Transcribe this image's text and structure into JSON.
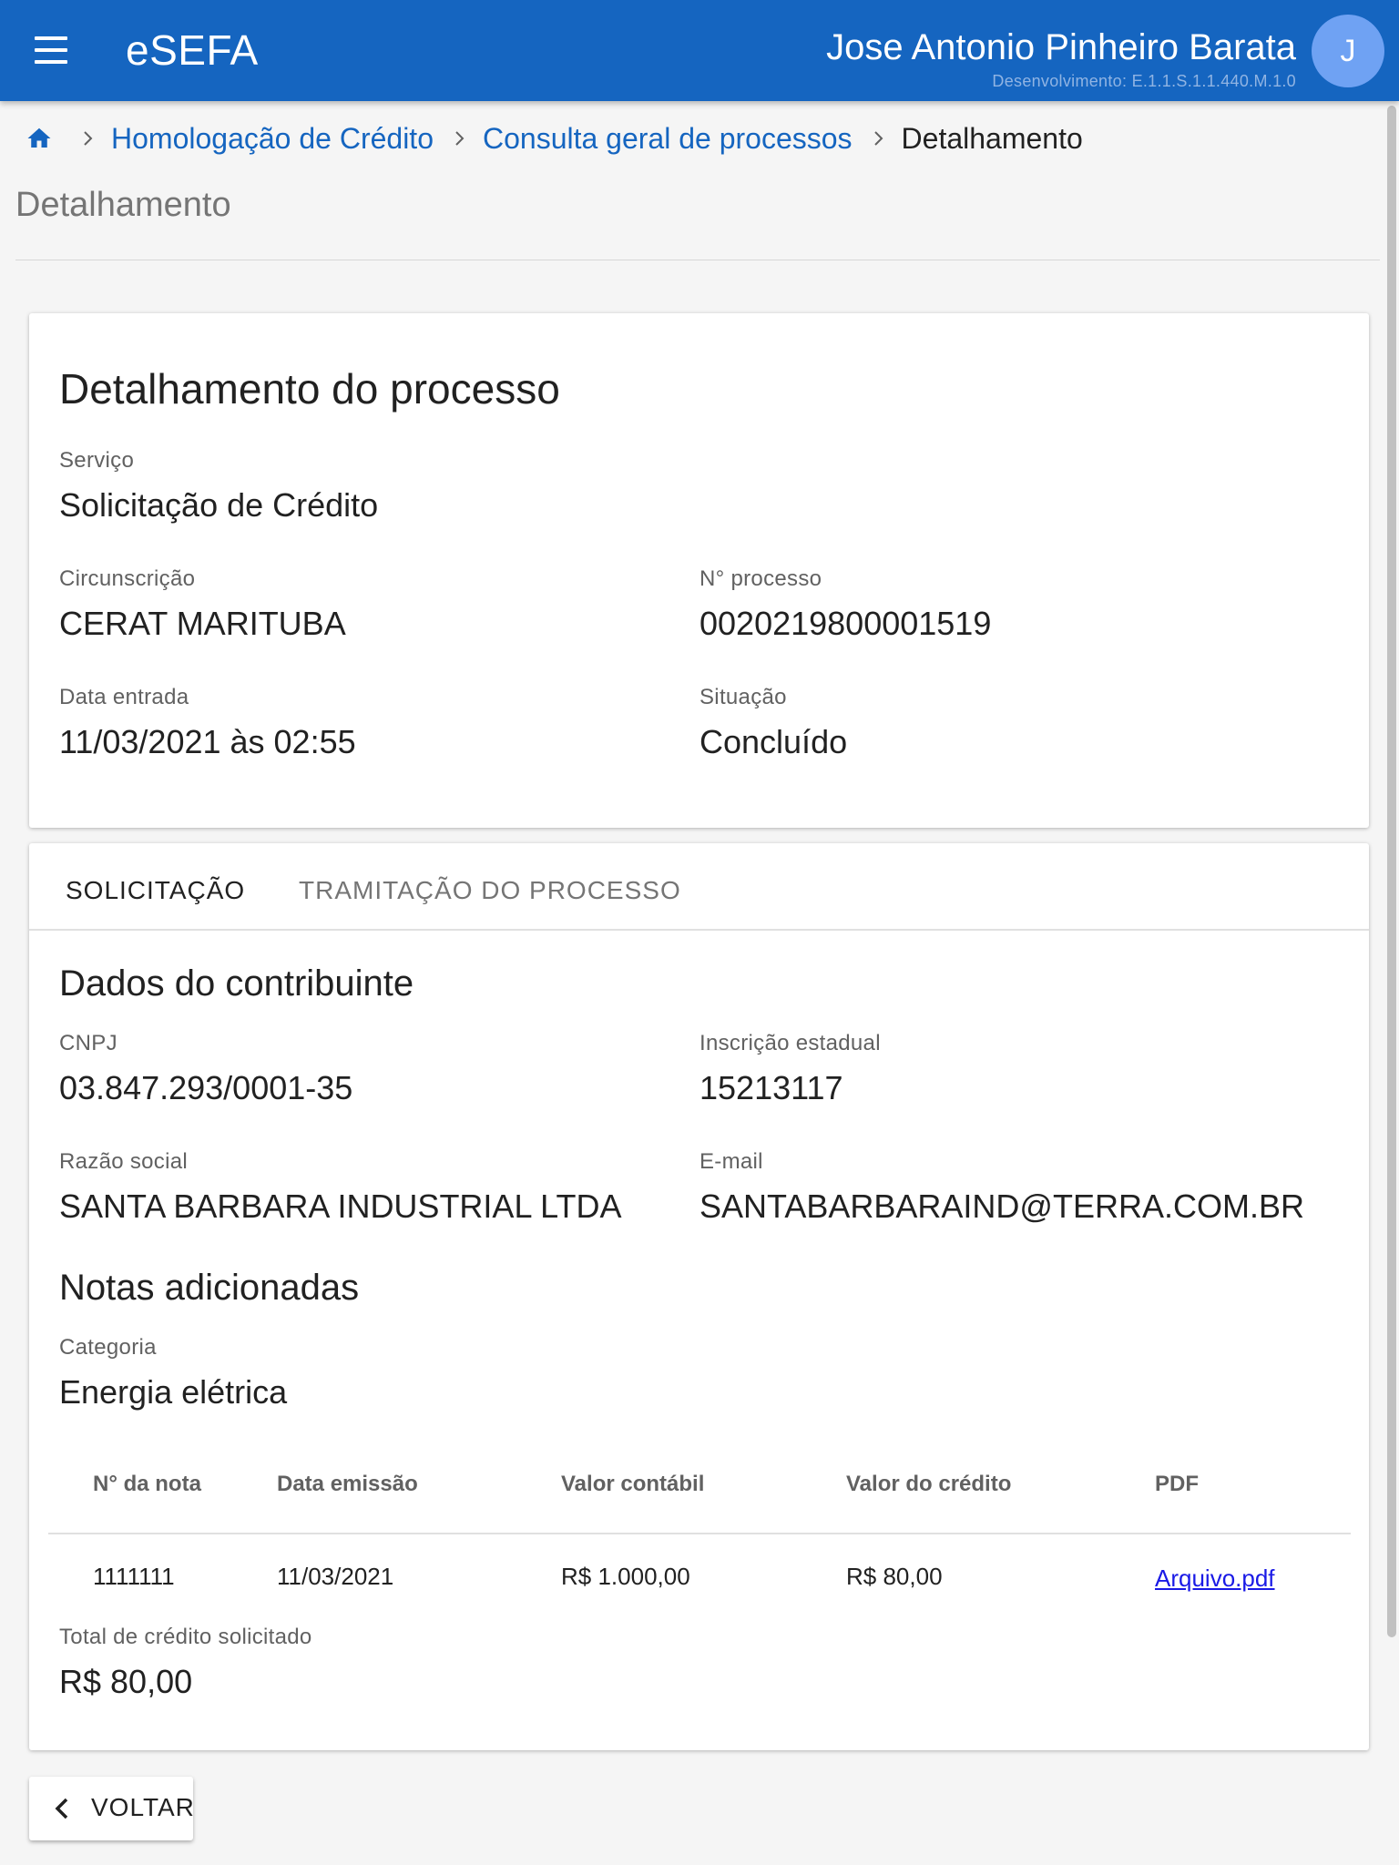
{
  "appbar": {
    "title": "eSEFA",
    "user_name": "Jose Antonio Pinheiro Barata",
    "environment": "Desenvolvimento: E.1.1.S.1.1.440.M.1.0",
    "avatar_initial": "J",
    "color": "#1565c0"
  },
  "breadcrumb": {
    "items": [
      "Homologação de Crédito",
      "Consulta geral de processos"
    ],
    "current": "Detalhamento"
  },
  "page_title": "Detalhamento",
  "process": {
    "heading": "Detalhamento do processo",
    "servico_label": "Serviço",
    "servico_value": "Solicitação de Crédito",
    "circunscricao_label": "Circunscrição",
    "circunscricao_value": "CERAT MARITUBA",
    "numero_label": "N° processo",
    "numero_value": "0020219800001519",
    "data_entrada_label": "Data entrada",
    "data_entrada_value": "11/03/2021 às 02:55",
    "situacao_label": "Situação",
    "situacao_value": "Concluído"
  },
  "tabs": [
    {
      "label": "SOLICITAÇÃO",
      "active": true
    },
    {
      "label": "TRAMITAÇÃO DO PROCESSO",
      "active": false
    }
  ],
  "contribuinte": {
    "heading": "Dados do contribuinte",
    "cnpj_label": "CNPJ",
    "cnpj_value": "03.847.293/0001-35",
    "ie_label": "Inscrição estadual",
    "ie_value": "15213117",
    "razao_label": "Razão social",
    "razao_value": "SANTA BARBARA INDUSTRIAL LTDA",
    "email_label": "E-mail",
    "email_value": "SANTABARBARAIND@TERRA.COM.BR"
  },
  "notas": {
    "heading": "Notas adicionadas",
    "categoria_label": "Categoria",
    "categoria_value": "Energia elétrica",
    "columns": [
      "N° da nota",
      "Data emissão",
      "Valor contábil",
      "Valor do crédito",
      "PDF"
    ],
    "rows": [
      {
        "numero": "1111111",
        "data": "11/03/2021",
        "valor_contabil": "R$ 1.000,00",
        "valor_credito": "R$ 80,00",
        "pdf": "Arquivo.pdf"
      }
    ],
    "total_label": "Total de crédito solicitado",
    "total_value": "R$ 80,00"
  },
  "back_button": {
    "label": "VOLTAR",
    "icon": "chevron-left-icon"
  }
}
